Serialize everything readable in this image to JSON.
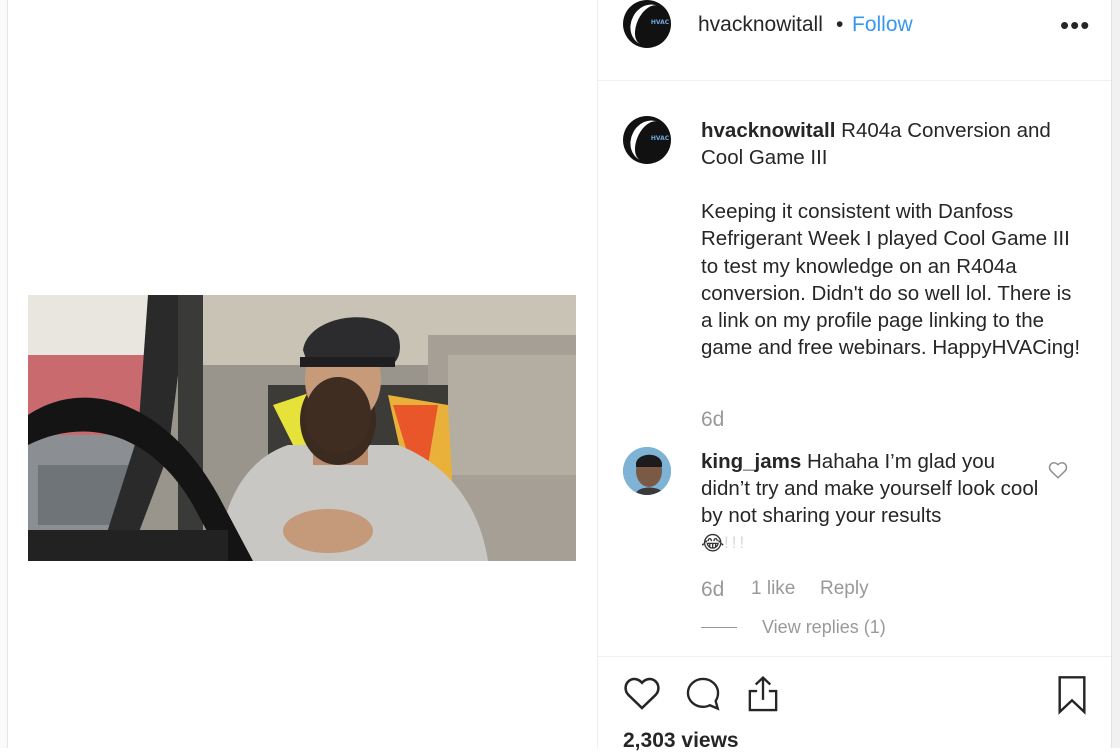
{
  "header": {
    "username": "hvacknowitall",
    "separator": "•",
    "follow_label": "Follow",
    "more_label": "•••",
    "avatar_logo_text": "HVAC"
  },
  "post": {
    "username": "hvacknowitall",
    "title": "R404a Conversion and Cool Game III",
    "body": "Keeping it consistent with Danfoss Refrigerant Week I played Cool Game III to test my knowledge on an R404a conversion. Didn't do so well lol. There is a link on my profile page linking to the game and free webinars. HappyHVACing!",
    "time": "6d"
  },
  "comment": {
    "username": "king_jams",
    "text": "Hahaha I’m glad you didn’t try and make yourself look cool by not sharing your results",
    "emoji": "😂",
    "emoji_tail": "!!!",
    "time": "6d",
    "likes": "1 like",
    "reply_label": "Reply",
    "view_replies": "View replies (1)"
  },
  "actions": {
    "views": "2,303 views"
  },
  "colors": {
    "accent": "#3897f0",
    "text": "#262626",
    "muted": "#999999"
  }
}
